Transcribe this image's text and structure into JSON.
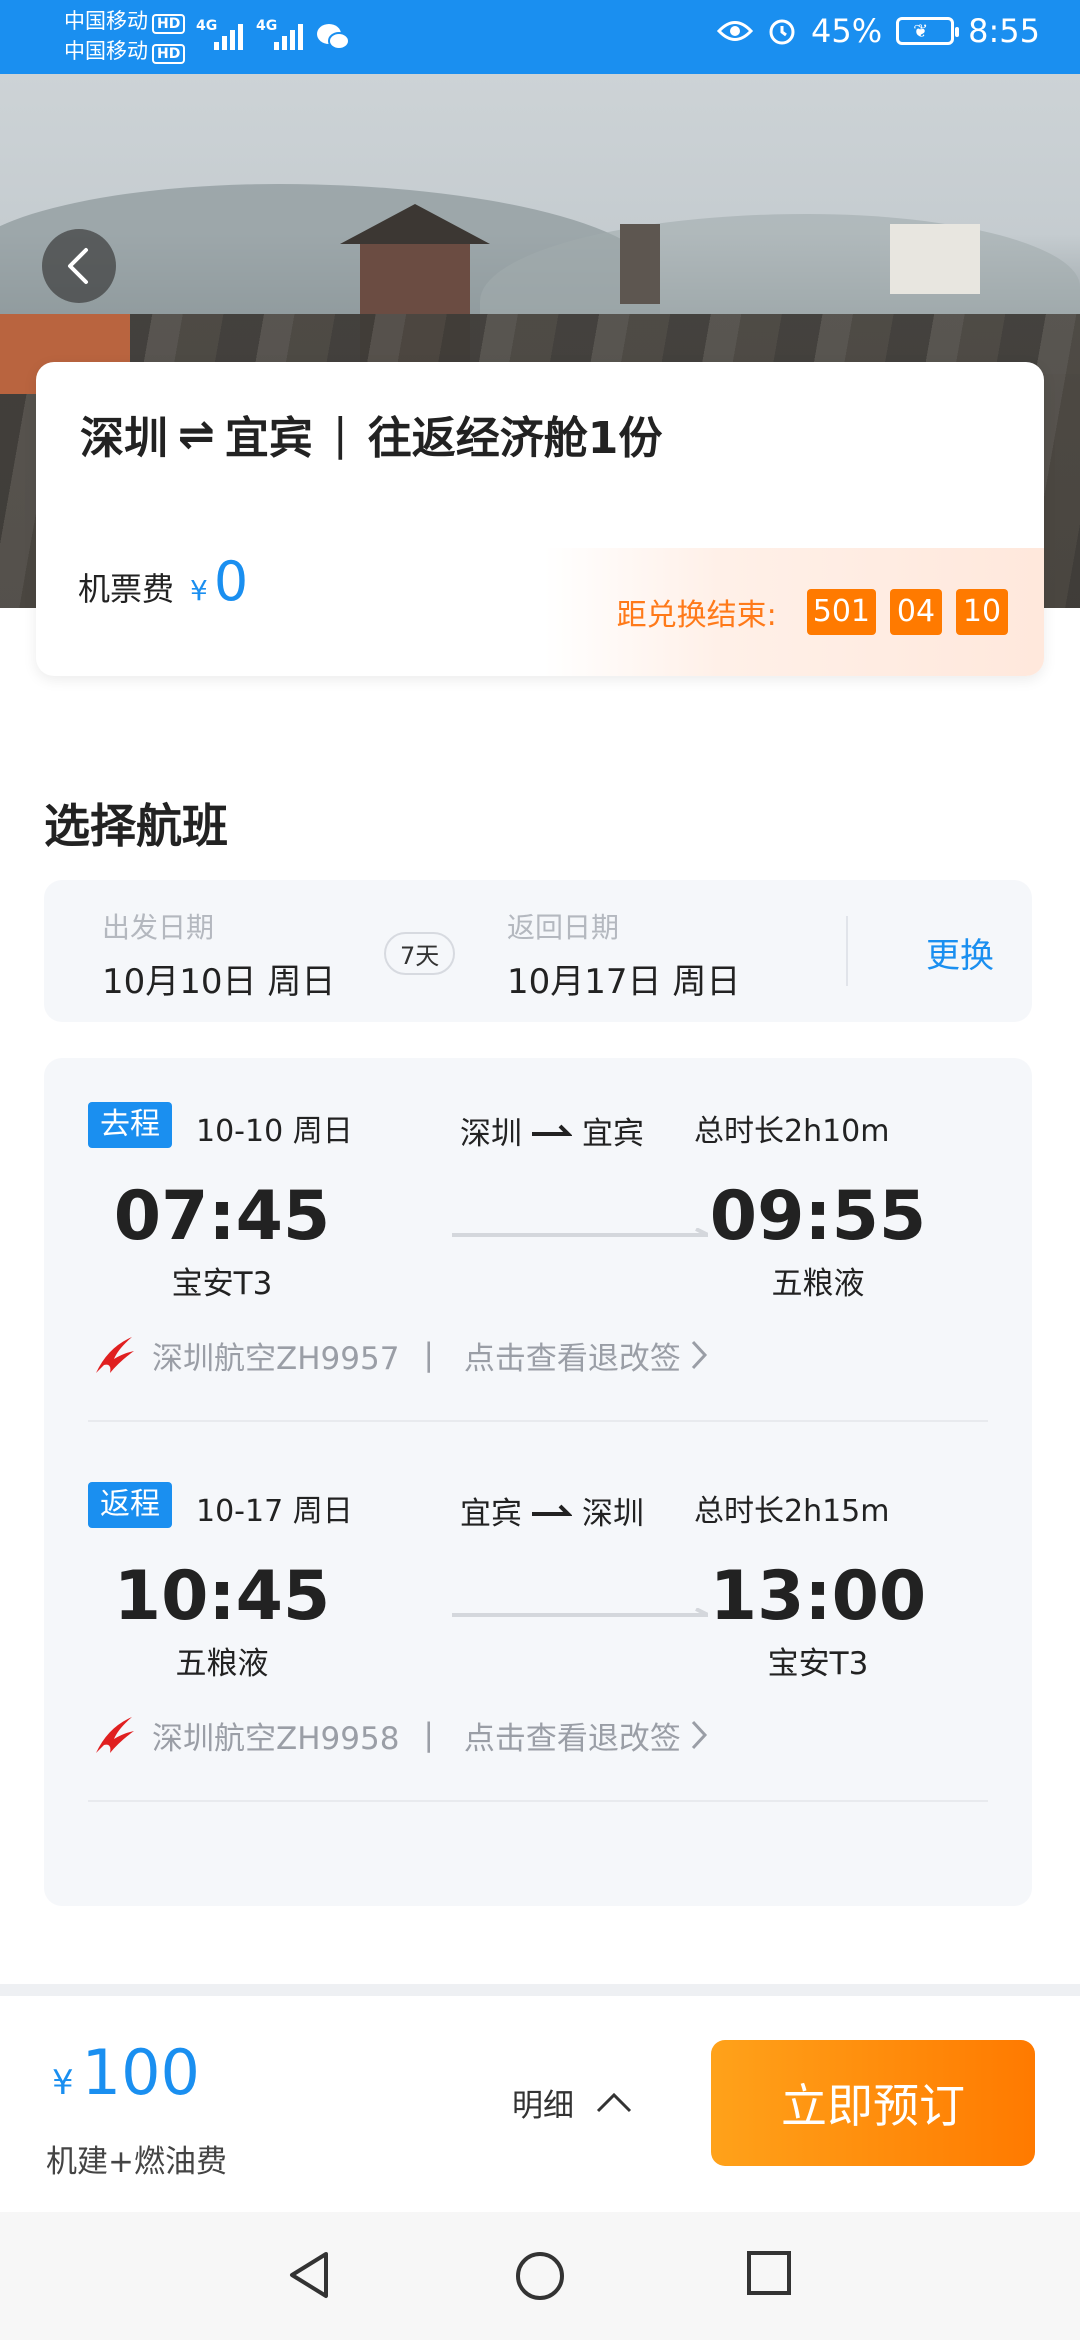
{
  "status_bar": {
    "carrier1": "中国移动",
    "carrier2": "中国移动",
    "hd": "HD",
    "network1": "4G",
    "network2": "4G",
    "battery": "45%",
    "time": "8:55"
  },
  "header": {
    "route_from": "深圳",
    "route_to": "宜宾",
    "route_swap_symbol": "⇌",
    "separator": "|",
    "product": "往返经济舱1份",
    "fare_label": "机票费",
    "fare_currency": "¥",
    "fare_value": "0",
    "countdown_label": "距兑换结束:",
    "countdown_d": "501",
    "countdown_h": "04",
    "countdown_m": "10"
  },
  "section_title": "选择航班",
  "dates": {
    "depart_caption": "出发日期",
    "depart_value": "10月10日 周日",
    "days": "7天",
    "return_caption": "返回日期",
    "return_value": "10月17日 周日",
    "change_label": "更换"
  },
  "segments": [
    {
      "badge": "去程",
      "date": "10-10 周日",
      "from": "深圳",
      "to": "宜宾",
      "duration": "总时长2h10m",
      "dep_time": "07:45",
      "dep_airport": "宝安T3",
      "arr_time": "09:55",
      "arr_airport": "五粮液",
      "airline": "深圳航空ZH9957",
      "sep": "|",
      "rules_link": "点击查看退改签"
    },
    {
      "badge": "返程",
      "date": "10-17 周日",
      "from": "宜宾",
      "to": "深圳",
      "duration": "总时长2h15m",
      "dep_time": "10:45",
      "dep_airport": "五粮液",
      "arr_time": "13:00",
      "arr_airport": "宝安T3",
      "airline": "深圳航空ZH9958",
      "sep": "|",
      "rules_link": "点击查看退改签"
    }
  ],
  "bottom": {
    "currency": "¥",
    "price": "100",
    "price_note": "机建+燃油费",
    "detail_label": "明细",
    "book_label": "立即预订"
  },
  "colors": {
    "accent": "#1a8ff0",
    "orange": "#ff7a00",
    "airline_red": "#e02020"
  }
}
